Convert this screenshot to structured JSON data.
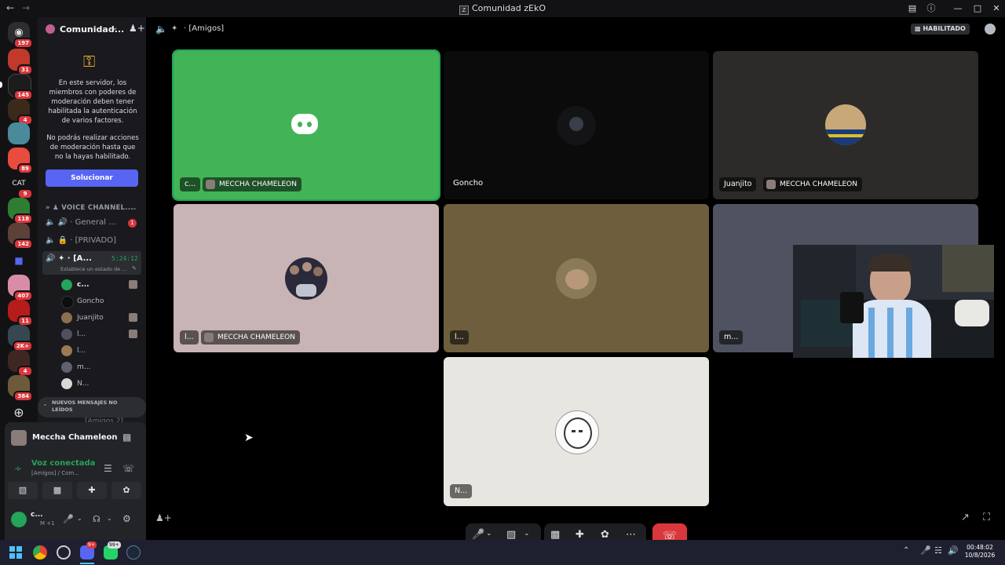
{
  "window": {
    "title": "Comunidad zEkO"
  },
  "rail": {
    "badges": [
      "197",
      "31",
      "145",
      "4",
      "89",
      "9",
      "118",
      "142",
      "407",
      "11",
      "2K+",
      "4",
      "384"
    ],
    "cat_label": "CAT"
  },
  "sidebar": {
    "server_name": "Comunidad...",
    "notice_1": "En este servidor, los miembros con poderes de moderación deben tener habilitada la autenticación de varios factores.",
    "notice_2": "No podrás realizar acciones de moderación hasta que no la hayas habilitado.",
    "fix_button": "Solucionar",
    "category": "VOICE CHANNEL...",
    "channels": [
      {
        "label": "General ...",
        "badge": "1"
      },
      {
        "label": "[PRIVADO]"
      },
      {
        "label": "[A...",
        "timer": "5:24:12",
        "status": "Establece un estado de ..."
      }
    ],
    "members": [
      "c...",
      "Goncho",
      "Juanjito",
      "l...",
      "l...",
      "m...",
      "N..."
    ],
    "new_messages": "NUEVOS MENSAJES NO LEÍDOS",
    "hidden_channel": "[Amigos 2]"
  },
  "userpanel": {
    "stream_name": "Meccha Chameleon",
    "voice_status": "Voz conectada",
    "voice_location": "[Amigos] / Com...",
    "username": "c...",
    "user_sub": "M +1"
  },
  "header": {
    "channel": "[Amigos]",
    "live_badge": "HABILITADO"
  },
  "tiles": [
    {
      "name": "c...",
      "stream": "MECCHA CHAMELEON"
    },
    {
      "name": "Goncho"
    },
    {
      "name": "Juanjito",
      "stream": "MECCHA CHAMELEON"
    },
    {
      "name": "l...",
      "stream": "MECCHA CHAMELEON"
    },
    {
      "name": "l..."
    },
    {
      "name": "m..."
    },
    {
      "name": "N..."
    }
  ],
  "taskbar": {
    "time": "00:48:02",
    "date": "10/8/2026",
    "discord_badge": "9+",
    "whatsapp_badge": "99+"
  },
  "colors": {
    "blurple": "#5865f2",
    "green_tile": "#43b357",
    "hangup": "#da373c",
    "voice_green": "#23a55a"
  }
}
